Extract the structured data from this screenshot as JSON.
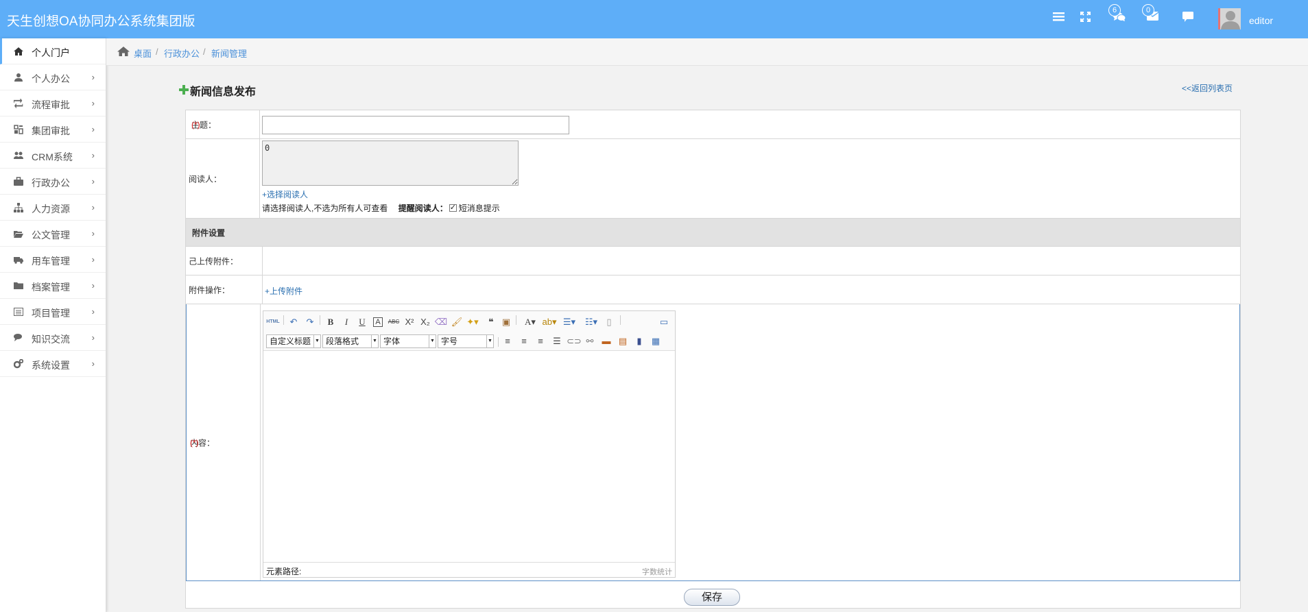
{
  "app": {
    "title": "天生创想OA协同办公系统集团版"
  },
  "header": {
    "messages_badge": "6",
    "mail_badge": "0",
    "username": "editor",
    "icons": [
      "menu-icon",
      "fullscreen-icon",
      "comments-icon",
      "envelope-icon",
      "chat-icon"
    ]
  },
  "sidebar": {
    "items": [
      {
        "label": "个人门户",
        "icon": "home-icon",
        "active": true
      },
      {
        "label": "个人办公",
        "icon": "user-icon"
      },
      {
        "label": "流程审批",
        "icon": "retweet-icon"
      },
      {
        "label": "集团审批",
        "icon": "dashboard-icon"
      },
      {
        "label": "CRM系统",
        "icon": "users-icon"
      },
      {
        "label": "行政办公",
        "icon": "briefcase-icon"
      },
      {
        "label": "人力资源",
        "icon": "sitemap-icon"
      },
      {
        "label": "公文管理",
        "icon": "folder-open-icon"
      },
      {
        "label": "用车管理",
        "icon": "truck-icon"
      },
      {
        "label": "档案管理",
        "icon": "folder-icon"
      },
      {
        "label": "项目管理",
        "icon": "list-alt-icon"
      },
      {
        "label": "知识交流",
        "icon": "comments-icon"
      },
      {
        "label": "系统设置",
        "icon": "cogs-icon"
      }
    ],
    "chevron": "›"
  },
  "breadcrumb": {
    "items": [
      "桌面",
      "行政办公",
      "新闻管理"
    ],
    "separator": "/"
  },
  "page": {
    "title": "新闻信息发布",
    "back_link": "<<返回列表页"
  },
  "form": {
    "subject": {
      "label": "主题：",
      "required": "(*)",
      "value": ""
    },
    "readers": {
      "label": "阅读人：",
      "value": "0",
      "select_link": "+选择阅读人",
      "hint": "请选择阅读人,不选为所有人可查看",
      "remind_label": "提醒阅读人：",
      "sms_label": "短消息提示",
      "sms_checked": true
    },
    "attachment_section": "附件设置",
    "uploaded": {
      "label": "己上传附件："
    },
    "attach_op": {
      "label": "附件操作：",
      "upload_link": "+上传附件"
    },
    "content": {
      "label": "内容：",
      "required": "(*)",
      "selects": [
        "自定义标题",
        "段落格式",
        "字体",
        "字号"
      ],
      "element_path": "元素路径:",
      "word_count": "字数统计"
    },
    "save_label": "保存"
  },
  "colors": {
    "topbar": "#5eaef8",
    "link": "#2a6fb0",
    "required": "#e02020"
  }
}
